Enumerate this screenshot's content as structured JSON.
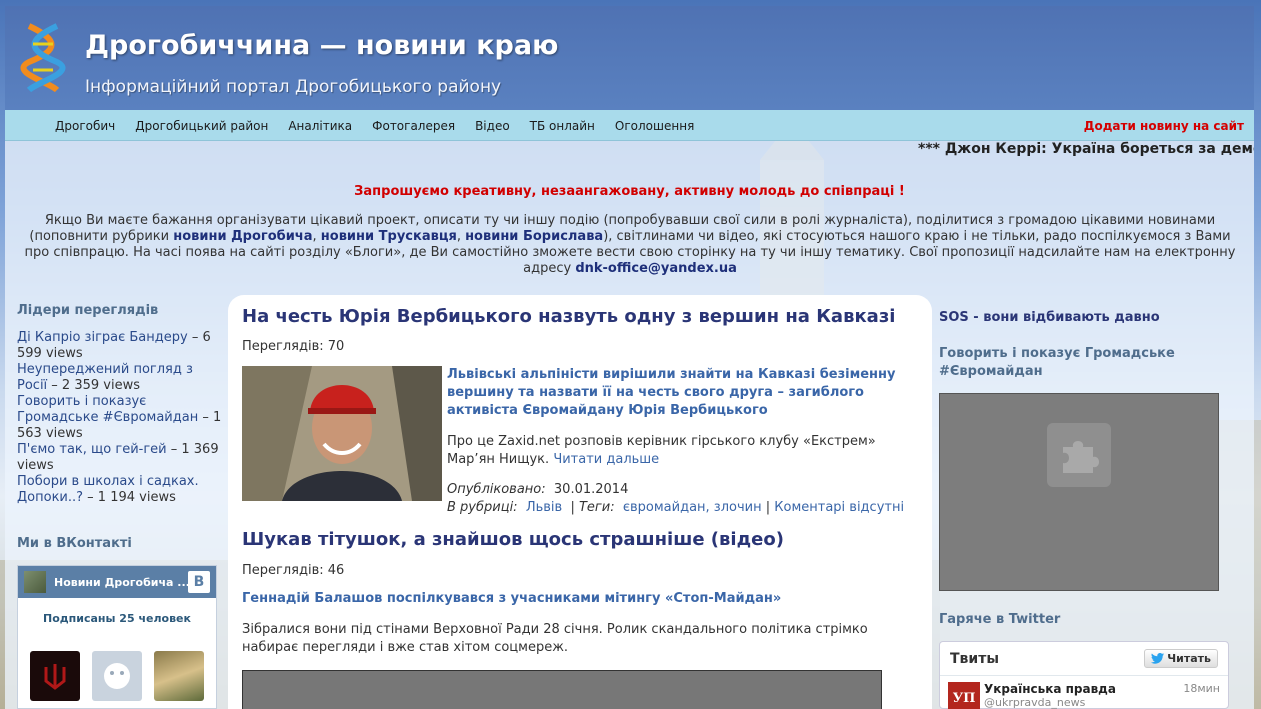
{
  "header": {
    "title": "Дрогобиччина — новини краю",
    "subtitle": "Інформаційний портал Дрогобицького району"
  },
  "nav": {
    "items": [
      "Дрогобич",
      "Дрогобицький район",
      "Аналітика",
      "Фотогалерея",
      "Відео",
      "ТБ онлайн",
      "Оголошення"
    ],
    "add_news": "Додати новину на сайт"
  },
  "ticker": "*** Джон Керрі: Україна бореться за демокр",
  "invite": {
    "heading": "Запрошуємо креативну, незаангажовану, активну молодь до співпраці !",
    "text_1": "Якщо Ви маєте бажання організувати цікавий проект, описати ту чи іншу подію (попробувавши свої сили в ролі журналіста), поділитися з громадою цікавими новинами (поповнити рубрики ",
    "link_1": "новини Дрогобича",
    "sep_1": ", ",
    "link_2": "новини Трускавця",
    "sep_2": ", ",
    "link_3": "новини Борислава",
    "text_2": "), світлинами чи відео, які стосуються нашого краю і не тільки, радо поспілкуємося  з Вами про співпрацю. На часі поява на сайті розділу «Блоги», де Ви самостійно зможете вести свою сторінку на ту чи іншу тематику. Свої пропозиції надсилайте нам на електронну адресу ",
    "email": "dnk-office@yandex.ua"
  },
  "leaders": {
    "title": "Лідери переглядів",
    "items": [
      {
        "title": "Ді Капріо зіграє Бандеру",
        "views": " – 6 599 views"
      },
      {
        "title": "Неупереджений погляд з Росії",
        "views": " – 2 359 views"
      },
      {
        "title": "Говорить і показує Громадське #Євромайдан",
        "views": " – 1 563 views"
      },
      {
        "title": "П'ємо так, що гей-гей",
        "views": " – 1 369 views"
      },
      {
        "title": "Побори в школах і садках. Допоки..?",
        "views": " – 1 194 views"
      }
    ]
  },
  "vk": {
    "title": "Ми в ВКонтакті",
    "group_name": "Новини Дрогобича ...",
    "logo": "В",
    "subscribers": "Подписаны 25 человек"
  },
  "posts": [
    {
      "title": "На честь Юрія Вербицького назвуть одну з вершин на Кавказі",
      "views": "Переглядів: 70",
      "lead": "Львівські альпіністи вирішили знайти на Кавказі безіменну вершину та назвати її на честь свого друга – загиблого активіста Євромайдану Юрія Вербицького",
      "body": "Про це Zaxid.net розповів керівник гірського клубу «Екстрем» Мар’ян Нищук. ",
      "read_more": "Читати дальше",
      "published_label": "Опубліковано:",
      "published": "30.01.2014",
      "rubric_label": "В рубриці:",
      "rubric": "Львів",
      "tags_label": "Теги:",
      "tags": "євромайдан, злочин",
      "comments": "Коментарі відсутні"
    },
    {
      "title": "Шукав тітушок, а знайшов щось страшніше (відео)",
      "views": "Переглядів: 46",
      "lead": "Геннадій Балашов поспілкувався з учасниками мітингу «Стоп-Майдан»",
      "body": "Зібралися вони під стінами Верховної Ради 28 січня. Ролик скандального політика стрімко набирає перегляди і вже став хітом соцмереж."
    }
  ],
  "right": {
    "sos_link": "SOS - вони відбивають давно",
    "hromadske_title": "Говорить і показує Громадське #Євромайдан",
    "twitter_title": "Гаряче в Twitter",
    "tw_head": "Твиты",
    "tw_follow": "Читать",
    "tw_ava": "УП",
    "tw_name": "Українська правда",
    "tw_handle": "@ukrpravda_news",
    "tw_time": "18мин"
  },
  "colors": {
    "header_bg": "#4f72b3",
    "nav_bg": "#a9dbeb",
    "add_news": "#d40000",
    "title_link": "#2a3576",
    "lead_link": "#3a66a8"
  }
}
